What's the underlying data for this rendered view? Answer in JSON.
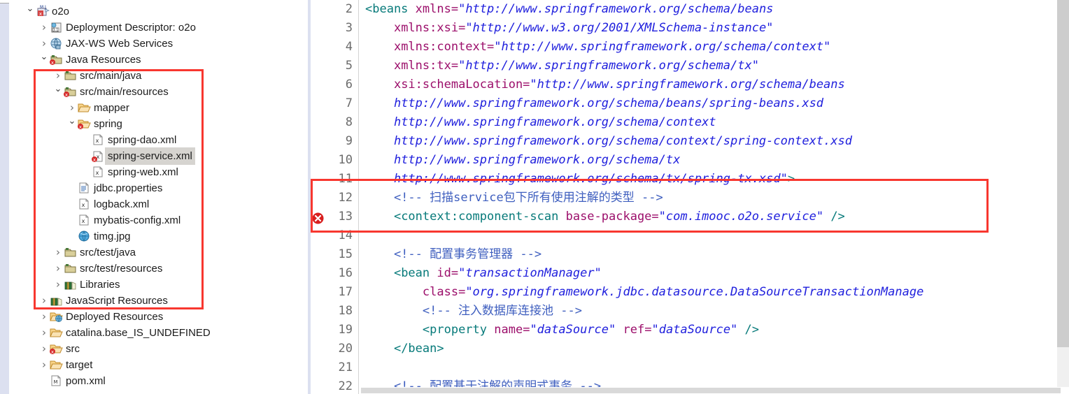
{
  "explorer": {
    "name": "project-explorer",
    "tree": [
      {
        "depth": 0,
        "twisty": "open",
        "icon": "maven-project-icon",
        "label": "o2o",
        "selected": false
      },
      {
        "depth": 1,
        "twisty": "closed",
        "icon": "deployment-descriptor-icon",
        "label": "Deployment Descriptor: o2o",
        "selected": false
      },
      {
        "depth": 1,
        "twisty": "closed",
        "icon": "jaxws-web-services-icon",
        "label": "JAX-WS Web Services",
        "selected": false
      },
      {
        "depth": 1,
        "twisty": "open",
        "icon": "java-resources-icon",
        "label": "Java Resources",
        "selected": false
      },
      {
        "depth": 2,
        "twisty": "closed",
        "icon": "source-folder-icon",
        "label": "src/main/java",
        "selected": false
      },
      {
        "depth": 2,
        "twisty": "open",
        "icon": "source-folder-error-icon",
        "label": "src/main/resources",
        "selected": false
      },
      {
        "depth": 3,
        "twisty": "closed",
        "icon": "folder-icon",
        "label": "mapper",
        "selected": false
      },
      {
        "depth": 3,
        "twisty": "open",
        "icon": "folder-error-icon",
        "label": "spring",
        "selected": false
      },
      {
        "depth": 4,
        "twisty": "none",
        "icon": "xml-file-icon",
        "label": "spring-dao.xml",
        "selected": false
      },
      {
        "depth": 4,
        "twisty": "none",
        "icon": "xml-file-error-icon",
        "label": "spring-service.xml",
        "selected": true
      },
      {
        "depth": 4,
        "twisty": "none",
        "icon": "xml-file-icon",
        "label": "spring-web.xml",
        "selected": false
      },
      {
        "depth": 3,
        "twisty": "none",
        "icon": "properties-file-icon",
        "label": "jdbc.properties",
        "selected": false
      },
      {
        "depth": 3,
        "twisty": "none",
        "icon": "xml-file-icon",
        "label": "logback.xml",
        "selected": false
      },
      {
        "depth": 3,
        "twisty": "none",
        "icon": "xml-file-icon",
        "label": "mybatis-config.xml",
        "selected": false
      },
      {
        "depth": 3,
        "twisty": "none",
        "icon": "image-file-icon",
        "label": "timg.jpg",
        "selected": false
      },
      {
        "depth": 2,
        "twisty": "closed",
        "icon": "source-folder-icon",
        "label": "src/test/java",
        "selected": false
      },
      {
        "depth": 2,
        "twisty": "closed",
        "icon": "source-folder-icon",
        "label": "src/test/resources",
        "selected": false
      },
      {
        "depth": 2,
        "twisty": "closed",
        "icon": "libraries-icon",
        "label": "Libraries",
        "selected": false
      },
      {
        "depth": 1,
        "twisty": "closed",
        "icon": "libraries-icon",
        "label": "JavaScript Resources",
        "selected": false
      },
      {
        "depth": 1,
        "twisty": "closed",
        "icon": "deployed-resources-icon",
        "label": "Deployed Resources",
        "selected": false
      },
      {
        "depth": 1,
        "twisty": "closed",
        "icon": "folder-icon",
        "label": "catalina.base_IS_UNDEFINED",
        "selected": false
      },
      {
        "depth": 1,
        "twisty": "closed",
        "icon": "folder-error-icon",
        "label": "src",
        "selected": false
      },
      {
        "depth": 1,
        "twisty": "closed",
        "icon": "folder-icon",
        "label": "target",
        "selected": false
      },
      {
        "depth": 1,
        "twisty": "none",
        "icon": "maven-pom-icon",
        "label": "pom.xml",
        "selected": false
      }
    ]
  },
  "editor": {
    "name": "xml-code-editor",
    "lines": [
      {
        "no": "2",
        "marker": "none",
        "segments": [
          {
            "t": "<beans ",
            "c": "tag"
          },
          {
            "t": "xmlns=",
            "c": "attr"
          },
          {
            "t": "\"http://www.springframework.org/schema/beans",
            "c": "str"
          }
        ]
      },
      {
        "no": "3",
        "marker": "none",
        "segments": [
          {
            "t": "    ",
            "c": "plain"
          },
          {
            "t": "xmlns:xsi=",
            "c": "attr"
          },
          {
            "t": "\"http://www.w3.org/2001/XMLSchema-instance\"",
            "c": "str"
          }
        ]
      },
      {
        "no": "4",
        "marker": "none",
        "segments": [
          {
            "t": "    ",
            "c": "plain"
          },
          {
            "t": "xmlns:context=",
            "c": "attr"
          },
          {
            "t": "\"http://www.springframework.org/schema/context\"",
            "c": "str"
          }
        ]
      },
      {
        "no": "5",
        "marker": "none",
        "segments": [
          {
            "t": "    ",
            "c": "plain"
          },
          {
            "t": "xmlns:tx=",
            "c": "attr"
          },
          {
            "t": "\"http://www.springframework.org/schema/tx\"",
            "c": "str"
          }
        ]
      },
      {
        "no": "6",
        "marker": "none",
        "segments": [
          {
            "t": "    ",
            "c": "plain"
          },
          {
            "t": "xsi:schemaLocation=",
            "c": "attr"
          },
          {
            "t": "\"http://www.springframework.org/schema/beans",
            "c": "str"
          }
        ]
      },
      {
        "no": "7",
        "marker": "none",
        "segments": [
          {
            "t": "    ",
            "c": "plain"
          },
          {
            "t": "http://www.springframework.org/schema/beans/spring-beans.xsd",
            "c": "str"
          }
        ]
      },
      {
        "no": "8",
        "marker": "none",
        "segments": [
          {
            "t": "    ",
            "c": "plain"
          },
          {
            "t": "http://www.springframework.org/schema/context",
            "c": "str"
          }
        ]
      },
      {
        "no": "9",
        "marker": "none",
        "segments": [
          {
            "t": "    ",
            "c": "plain"
          },
          {
            "t": "http://www.springframework.org/schema/context/spring-context.xsd",
            "c": "str"
          }
        ]
      },
      {
        "no": "10",
        "marker": "none",
        "segments": [
          {
            "t": "    ",
            "c": "plain"
          },
          {
            "t": "http://www.springframework.org/schema/tx",
            "c": "str"
          }
        ]
      },
      {
        "no": "11",
        "marker": "none",
        "segments": [
          {
            "t": "    ",
            "c": "plain"
          },
          {
            "t": "http://www.springframework.org/schema/tx/spring-tx.xsd\"",
            "c": "str"
          },
          {
            "t": ">",
            "c": "tag"
          }
        ]
      },
      {
        "no": "12",
        "marker": "none",
        "segments": [
          {
            "t": "    <!-- 扫描service包下所有使用注解的类型 -->",
            "c": "cmt"
          }
        ]
      },
      {
        "no": "13",
        "marker": "error",
        "segments": [
          {
            "t": "    ",
            "c": "plain"
          },
          {
            "t": "<context:component-scan ",
            "c": "tag"
          },
          {
            "t": "base-package=",
            "c": "attr"
          },
          {
            "t": "\"com.imooc.o2o.service\"",
            "c": "str"
          },
          {
            "t": " ",
            "c": "plain"
          },
          {
            "t": "/>",
            "c": "slash"
          }
        ]
      },
      {
        "no": "14",
        "marker": "none",
        "segments": []
      },
      {
        "no": "15",
        "marker": "none",
        "segments": [
          {
            "t": "    <!-- 配置事务管理器 -->",
            "c": "cmt"
          }
        ]
      },
      {
        "no": "16",
        "marker": "none",
        "segments": [
          {
            "t": "    ",
            "c": "plain"
          },
          {
            "t": "<bean ",
            "c": "tag"
          },
          {
            "t": "id=",
            "c": "attr"
          },
          {
            "t": "\"transactionManager\"",
            "c": "str"
          }
        ]
      },
      {
        "no": "17",
        "marker": "none",
        "segments": [
          {
            "t": "        ",
            "c": "plain"
          },
          {
            "t": "class=",
            "c": "attr"
          },
          {
            "t": "\"org.springframework.jdbc.datasource.DataSourceTransactionManage",
            "c": "str"
          }
        ]
      },
      {
        "no": "18",
        "marker": "none",
        "segments": [
          {
            "t": "        <!-- 注入数据库连接池 -->",
            "c": "cmt"
          }
        ]
      },
      {
        "no": "19",
        "marker": "none",
        "segments": [
          {
            "t": "        ",
            "c": "plain"
          },
          {
            "t": "<property ",
            "c": "tag"
          },
          {
            "t": "name=",
            "c": "attr"
          },
          {
            "t": "\"dataSource\"",
            "c": "str"
          },
          {
            "t": " ",
            "c": "plain"
          },
          {
            "t": "ref=",
            "c": "attr"
          },
          {
            "t": "\"dataSource\"",
            "c": "str"
          },
          {
            "t": " ",
            "c": "plain"
          },
          {
            "t": "/>",
            "c": "slash"
          }
        ]
      },
      {
        "no": "20",
        "marker": "none",
        "segments": [
          {
            "t": "    ",
            "c": "plain"
          },
          {
            "t": "</bean>",
            "c": "tag"
          }
        ]
      },
      {
        "no": "21",
        "marker": "none",
        "segments": []
      },
      {
        "no": "22",
        "marker": "none",
        "segments": [
          {
            "t": "    <!-- 配置基于注解的声明式事务 -->",
            "c": "cmt"
          }
        ]
      }
    ]
  },
  "annotations": {
    "tree_highlight_label": "red-highlight-box-tree",
    "code_highlight_label": "red-highlight-box-code",
    "color": "#f8372f"
  },
  "scrollbars": {
    "vertical_arrow_glyph": "⌄"
  }
}
